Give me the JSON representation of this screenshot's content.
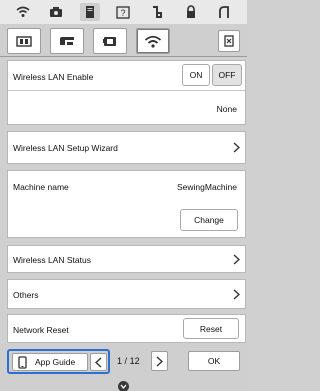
{
  "top_icons": [
    "wifi-icon",
    "camera-icon",
    "page-icon",
    "help-icon",
    "embroidery-icon",
    "lock-icon",
    "needle-icon"
  ],
  "tabs": [
    "sewing-settings-icon",
    "embroidery-settings-icon",
    "machine-settings-icon",
    "wireless-lan-icon"
  ],
  "rows": {
    "wlan_enable": {
      "label": "Wireless LAN Enable",
      "on": "ON",
      "off": "OFF",
      "status": "None"
    },
    "setup_wizard": {
      "label": "Wireless LAN Setup Wizard"
    },
    "machine_name": {
      "label": "Machine name",
      "value": "SewingMachine",
      "change": "Change"
    },
    "status": {
      "label": "Wireless LAN Status"
    },
    "others": {
      "label": "Others"
    },
    "network_reset": {
      "label": "Network Reset",
      "reset": "Reset"
    }
  },
  "bottom": {
    "app_guide": "App Guide",
    "page_current": "1",
    "page_separator": "/",
    "page_total": "12",
    "ok": "OK"
  },
  "colors": {
    "highlight": "#2d6fd3"
  }
}
